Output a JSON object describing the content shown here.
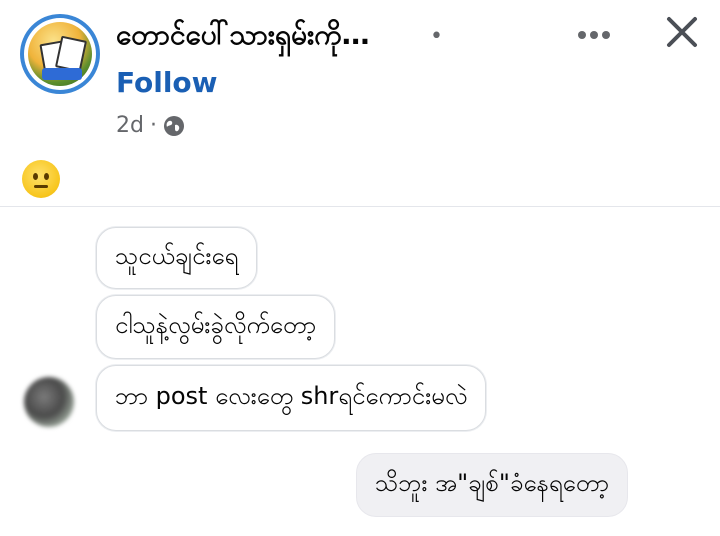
{
  "header": {
    "page_name": "တောင်ပေါ်သားရှမ်းကို…",
    "name_separator": "•",
    "follow_label": "Follow",
    "timestamp": "2d",
    "meta_separator": "·",
    "privacy_icon": "globe-icon",
    "more_icon": "more-dots-icon",
    "close_icon": "close-icon"
  },
  "post": {
    "emoji": "neutral-face-emoji"
  },
  "chat": {
    "incoming": [
      "သူငယ်ချင်းရေ",
      "ငါသူနဲ့လွမ်းခွဲလိုက်တော့",
      "ဘာ post လေးတွေ shrရင်ကောင်းမလဲ"
    ],
    "outgoing": [
      "သိဘူး အ\"ချစ်\"ခံနေရတော့"
    ]
  },
  "colors": {
    "follow": "#1a5fb4",
    "avatar_ring": "#3a86d6",
    "text": "#050505",
    "muted": "#65676b",
    "bubble_border": "#dadde1",
    "outgoing_bubble": "#f0f0f3"
  }
}
